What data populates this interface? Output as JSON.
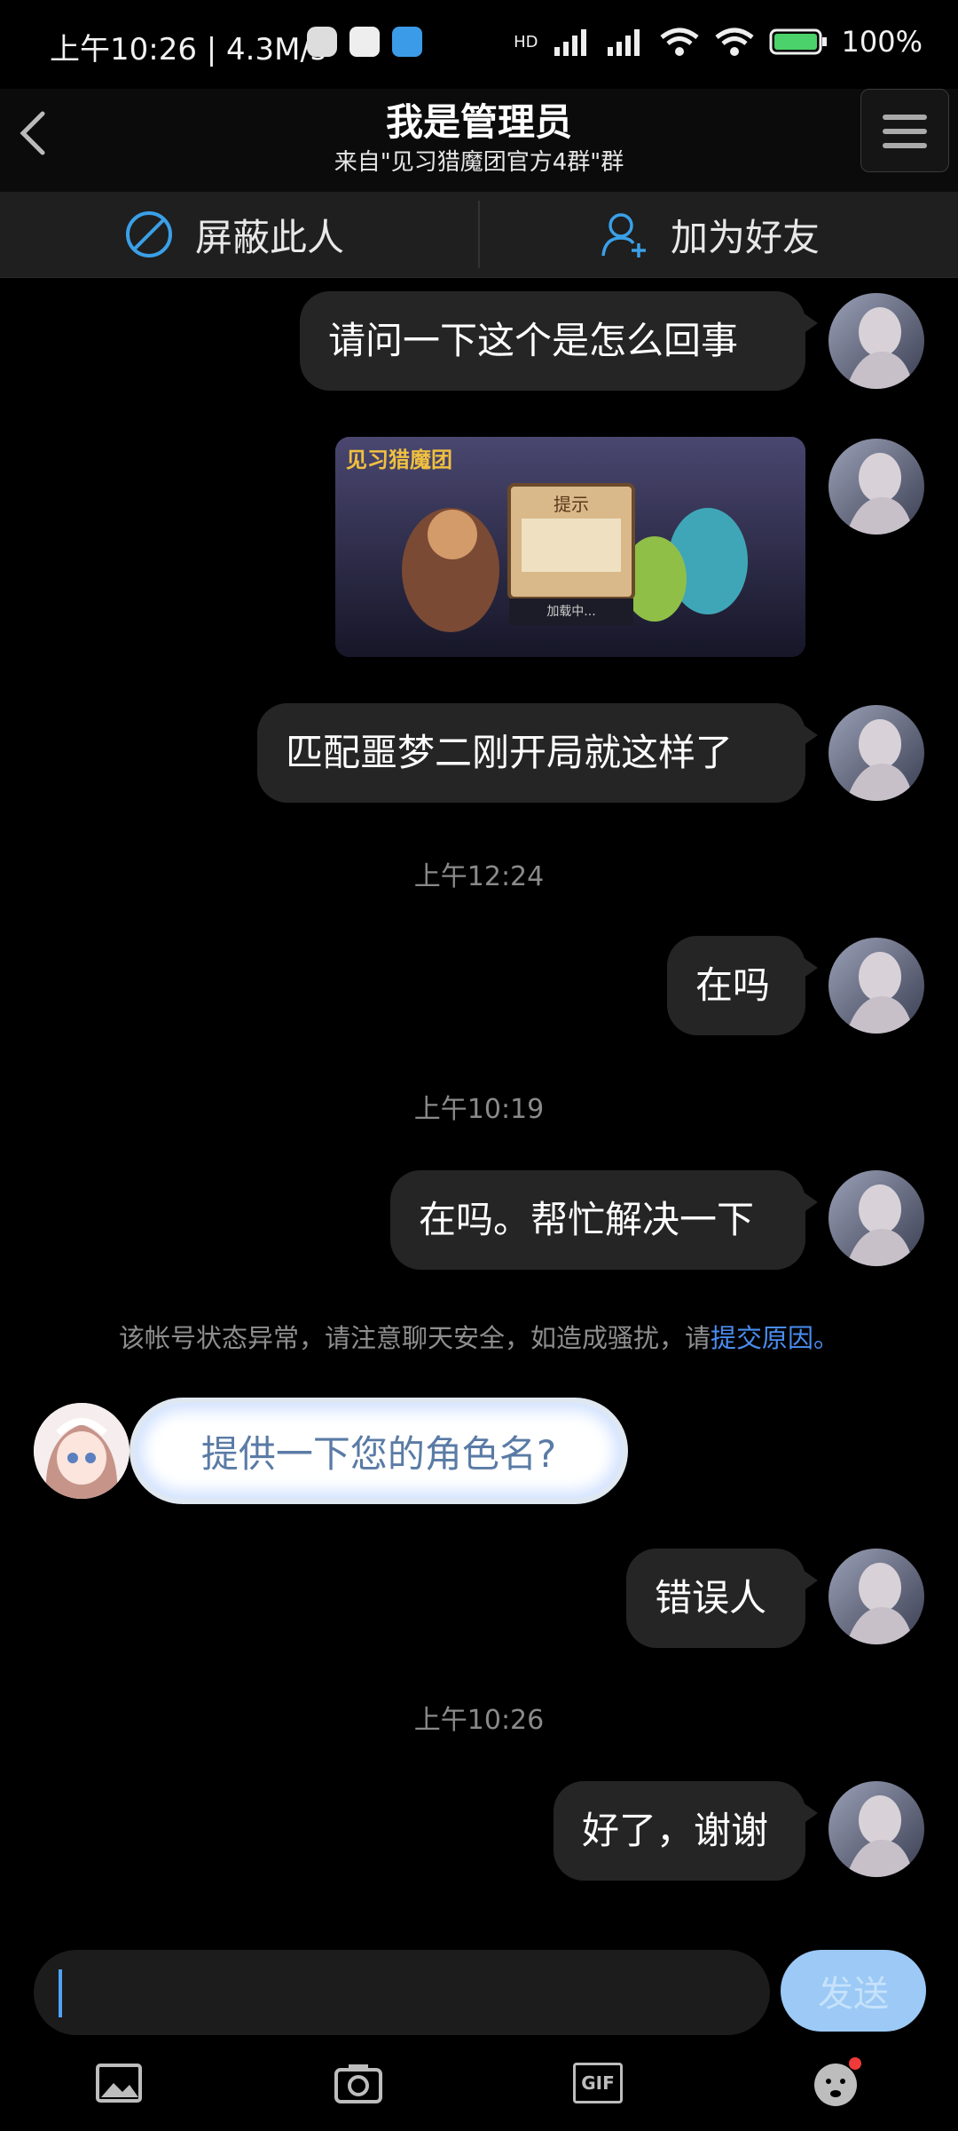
{
  "status_bar": {
    "time": "上午10:26 | 4.3M/s",
    "battery": "100%",
    "network": "HD"
  },
  "header": {
    "title": "我是管理员",
    "subtitle": "来自\"见习猎魔团官方4群\"群",
    "ghost_text": "在吗"
  },
  "actions": {
    "block": "屏蔽此人",
    "add_friend": "加为好友"
  },
  "messages": {
    "m1": "请问一下这个是怎么回事",
    "image_caption": "见习猎魔团",
    "image_dialog_title": "提示",
    "image_loading": "加载中...",
    "m2": "匹配噩梦二刚开局就这样了",
    "ts1": "上午12:24",
    "m3": "在吗",
    "ts2": "上午10:19",
    "m4": "在吗。帮忙解决一下",
    "notice_prefix": "该帐号状态异常，请注意聊天安全，如造成骚扰，请",
    "notice_link": "提交原因。",
    "admin_msg": "提供一下您的角色名?",
    "m5": "错误人",
    "ts3": "上午10:26",
    "m6": "好了，谢谢"
  },
  "input": {
    "value": "",
    "send": "发送"
  },
  "toolbar": {
    "gif": "GIF"
  },
  "colors": {
    "accent": "#4a8df0",
    "bubble": "#252525",
    "send_button": "#9cc9f6"
  }
}
